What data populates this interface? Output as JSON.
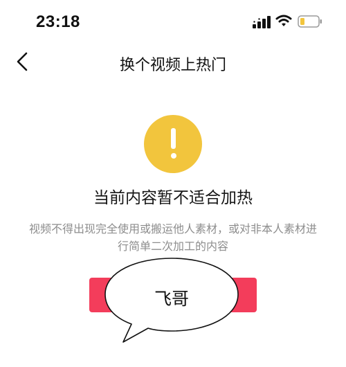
{
  "status_bar": {
    "time": "23:18",
    "icons": [
      "signal-icon",
      "wifi-icon",
      "battery-icon"
    ],
    "battery_color": "#f2c53d"
  },
  "nav": {
    "title": "换个视频上热门",
    "back_icon": "chevron-left-icon"
  },
  "notice": {
    "icon": "exclamation-icon",
    "icon_color": "#f2c53d",
    "headline": "当前内容暂不适合加热",
    "description": "视频不得出现完全使用或搬运他人素材，或对非本人素材进行简单二次加工的内容"
  },
  "action_button": {
    "label": "",
    "color": "#f33d5b"
  },
  "overlay": {
    "bubble_text": "飞哥"
  }
}
